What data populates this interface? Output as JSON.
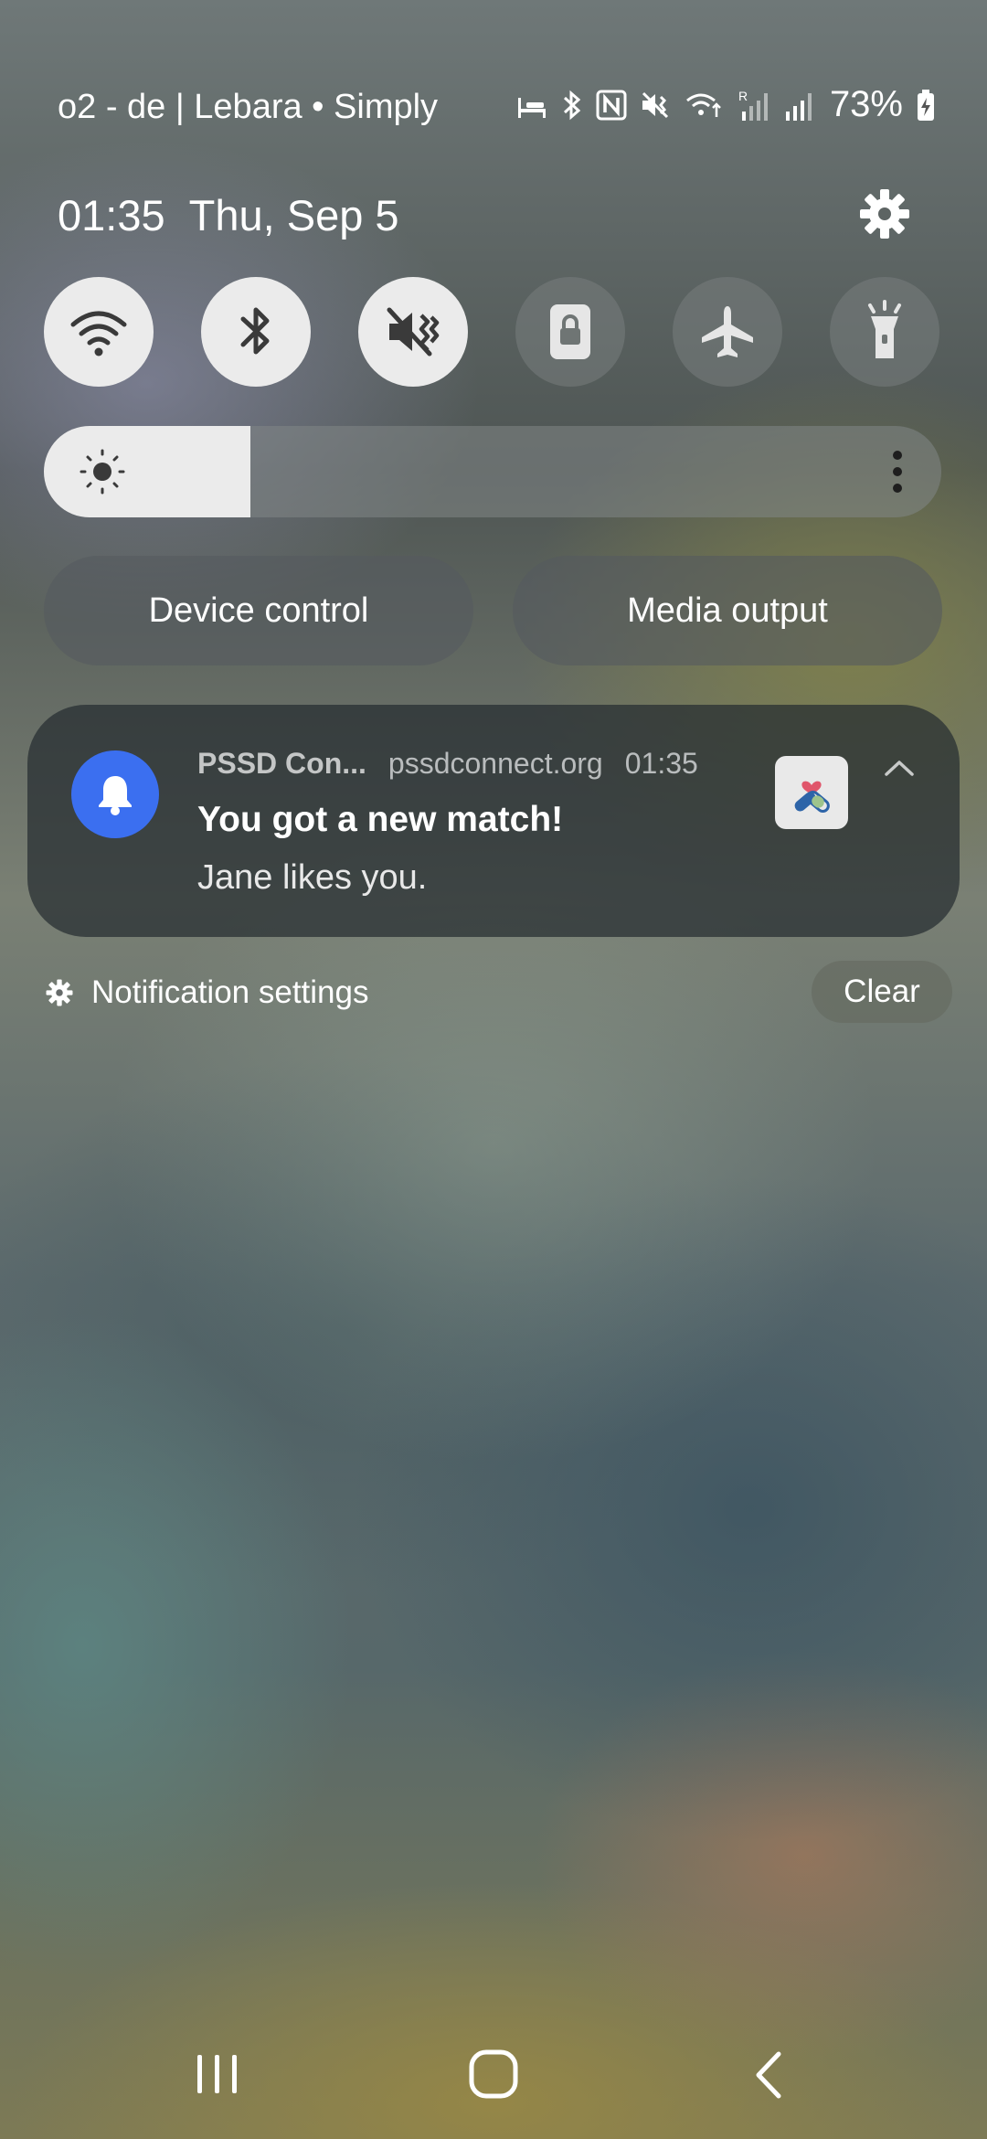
{
  "status_bar": {
    "carrier": "o2 - de | Lebara • Simply",
    "battery_percent": "73%",
    "icons": [
      "bed-icon",
      "bluetooth-icon",
      "nfc-icon",
      "mute-vibrate-icon",
      "wifi-data-icon",
      "signal-roaming-icon",
      "signal-icon",
      "battery-charging-icon"
    ]
  },
  "header": {
    "time": "01:35",
    "date": "Thu, Sep 5",
    "settings_icon": "gear-icon"
  },
  "quick_toggles": [
    {
      "name": "wifi",
      "icon": "wifi-icon",
      "state": "on"
    },
    {
      "name": "bluetooth",
      "icon": "bluetooth-icon",
      "state": "on"
    },
    {
      "name": "sound",
      "icon": "mute-vibrate-icon",
      "state": "on"
    },
    {
      "name": "rotation-lock",
      "icon": "lock-rotation-icon",
      "state": "off"
    },
    {
      "name": "airplane",
      "icon": "airplane-icon",
      "state": "off"
    },
    {
      "name": "flashlight",
      "icon": "flashlight-icon",
      "state": "off"
    }
  ],
  "brightness": {
    "level": 0.23,
    "icon": "sun-icon",
    "more_icon": "more-vertical-icon"
  },
  "buttons": {
    "device_control": "Device control",
    "media_output": "Media output"
  },
  "notification": {
    "app_name": "PSSD Con...",
    "source": "pssdconnect.org",
    "time": "01:35",
    "title": "You got a new match!",
    "body": "Jane likes you.",
    "app_icon": "bell-icon",
    "thumbnail_icon": "heart-pills-icon"
  },
  "footer": {
    "notification_settings": "Notification settings",
    "clear": "Clear"
  },
  "colors": {
    "accent_blue": "#3b6ff0",
    "toggle_on": "#ebebeb",
    "heart_red": "#e0566b"
  }
}
